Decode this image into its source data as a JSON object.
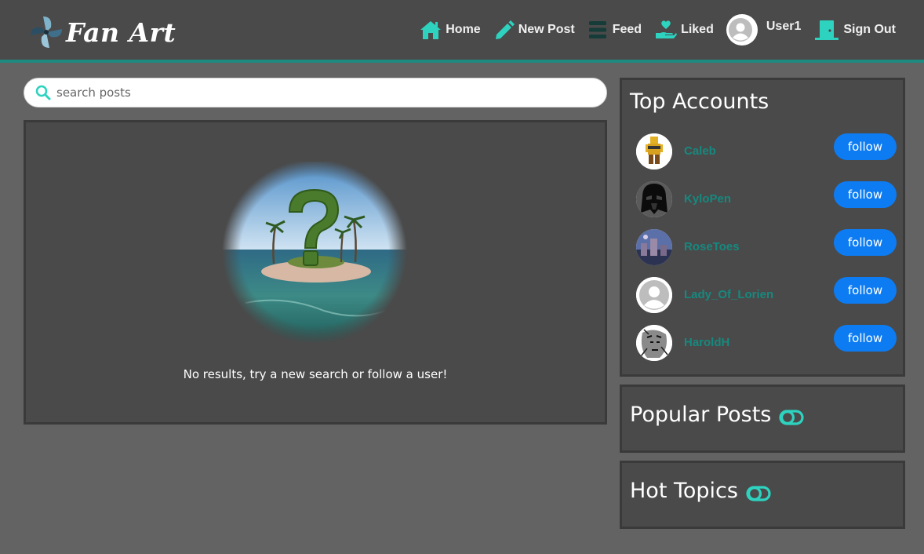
{
  "brand": {
    "name": "Fan Art",
    "logo_icon": "pinwheel-logo"
  },
  "nav": {
    "home": "Home",
    "new_post": "New Post",
    "feed": "Feed",
    "liked": "Liked",
    "user": "User1",
    "sign_out": "Sign Out"
  },
  "search": {
    "placeholder": "search posts",
    "value": ""
  },
  "feed": {
    "empty_message": "No results, try a new search or follow a user!",
    "empty_image": "question-mark-island"
  },
  "top_accounts": {
    "title": "Top Accounts",
    "follow_label": "follow",
    "accounts": [
      {
        "name": "Caleb",
        "avatar": "lego-figure"
      },
      {
        "name": "KyloPen",
        "avatar": "darth-vader-helmet"
      },
      {
        "name": "RoseToes",
        "avatar": "city-photo"
      },
      {
        "name": "Lady_Of_Lorien",
        "avatar": "default-avatar"
      },
      {
        "name": "HaroldH",
        "avatar": "sketch-portrait"
      }
    ]
  },
  "popular_posts": {
    "title": "Popular Posts",
    "toggle_state": "off"
  },
  "hot_topics": {
    "title": "Hot Topics",
    "toggle_state": "off"
  },
  "colors": {
    "accent": "#2ed3c0",
    "accent_dark": "#16897f",
    "follow_button": "#0d7cf2",
    "panel": "#4a4a4a",
    "background": "#636363"
  }
}
